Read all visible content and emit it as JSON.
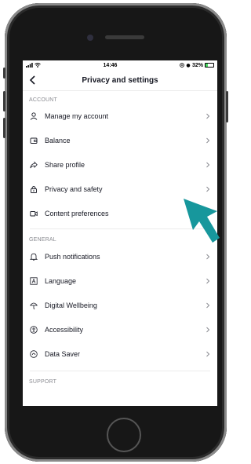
{
  "status_bar": {
    "time": "14:46",
    "battery": "32%",
    "battery_level": 0.32
  },
  "navbar": {
    "title": "Privacy and settings"
  },
  "sections": {
    "account": {
      "header": "ACCOUNT",
      "items": [
        {
          "label": "Manage my account",
          "icon": "person-icon"
        },
        {
          "label": "Balance",
          "icon": "wallet-icon"
        },
        {
          "label": "Share profile",
          "icon": "share-icon"
        },
        {
          "label": "Privacy and safety",
          "icon": "lock-icon"
        },
        {
          "label": "Content preferences",
          "icon": "video-icon"
        }
      ]
    },
    "general": {
      "header": "GENERAL",
      "items": [
        {
          "label": "Push notifications",
          "icon": "bell-icon"
        },
        {
          "label": "Language",
          "icon": "language-icon"
        },
        {
          "label": "Digital Wellbeing",
          "icon": "umbrella-icon"
        },
        {
          "label": "Accessibility",
          "icon": "accessibility-icon"
        },
        {
          "label": "Data Saver",
          "icon": "data-saver-icon"
        }
      ]
    },
    "support": {
      "header": "SUPPORT"
    }
  },
  "colors": {
    "arrow": "#17979c",
    "text": "#161823",
    "secondary": "#8a8b91"
  }
}
